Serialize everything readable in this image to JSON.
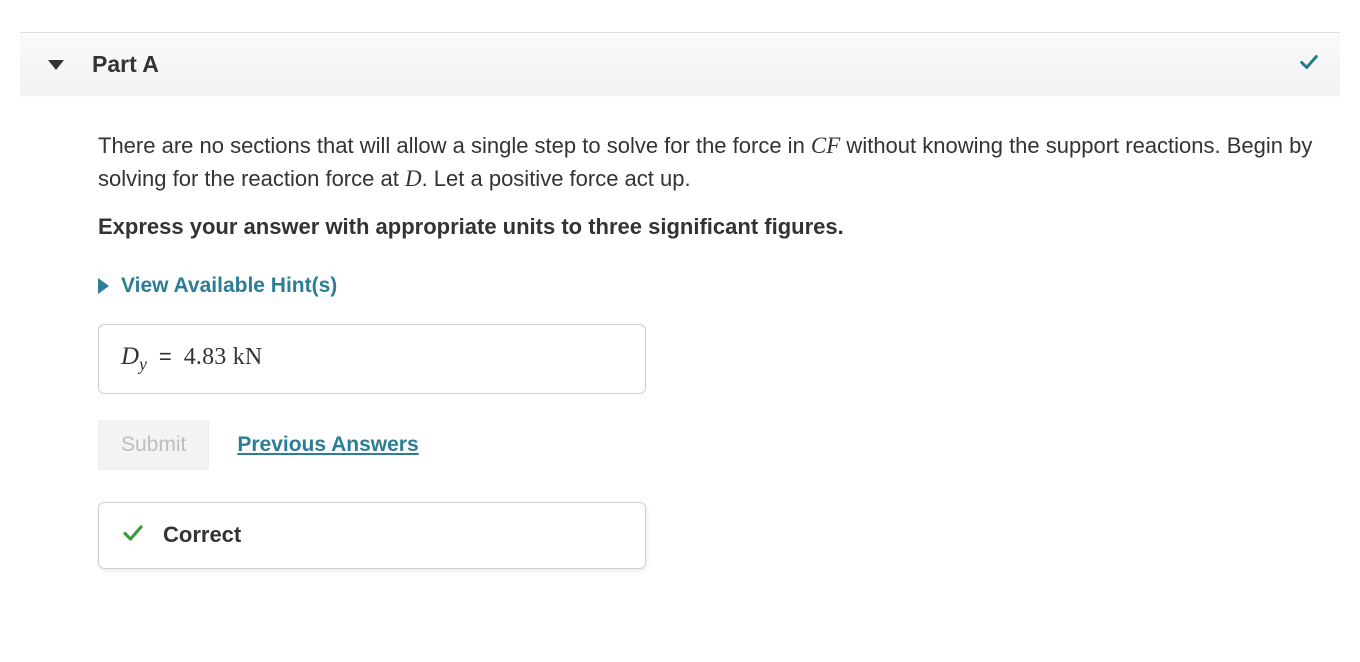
{
  "part": {
    "title": "Part A",
    "completed_icon": "check-icon"
  },
  "question": {
    "pre1": "There are no sections that will allow a single step to solve for the force in ",
    "var1": "CF",
    "mid1": " without knowing the support reactions. Begin by solving for the reaction force at ",
    "var2": "D",
    "post1": ". Let a positive force act up."
  },
  "instruction": "Express your answer with appropriate units to three significant figures.",
  "hints_label": "View Available Hint(s)",
  "answer": {
    "symbol": "D",
    "subscript": "y",
    "eq": "=",
    "value": "4.83 kN"
  },
  "submit_label": "Submit",
  "previous_answers_label": "Previous Answers",
  "feedback": {
    "status": "Correct"
  }
}
